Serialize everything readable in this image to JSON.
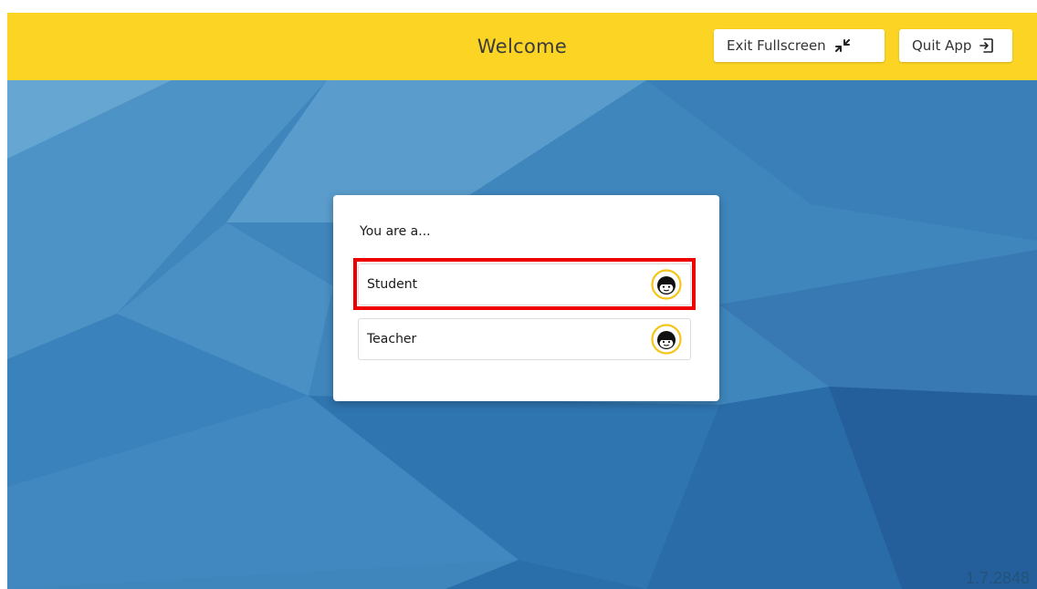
{
  "header": {
    "title": "Welcome",
    "exit_fullscreen_label": "Exit Fullscreen",
    "exit_fullscreen_icon": "collapse-arrows-icon",
    "quit_label": "Quit App",
    "quit_icon": "exit-door-icon"
  },
  "role_dialog": {
    "prompt": "You are a...",
    "options": [
      {
        "label": "Student",
        "icon": "student-face-icon",
        "highlighted": true
      },
      {
        "label": "Teacher",
        "icon": "teacher-face-icon",
        "highlighted": false
      }
    ]
  },
  "footer": {
    "version": "1.7.2848"
  },
  "colors": {
    "header_bg": "#fcd424",
    "background": "#3f86bd",
    "avatar_ring": "#f5c518",
    "highlight": "#ee0000"
  }
}
